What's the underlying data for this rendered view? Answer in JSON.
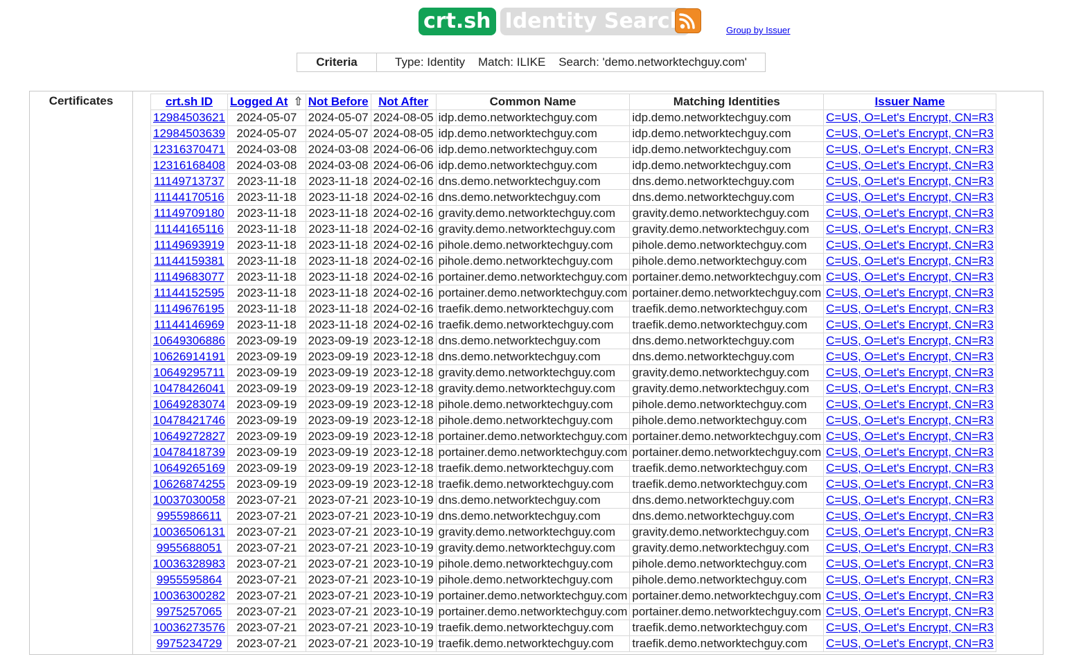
{
  "header": {
    "brand": "crt.sh",
    "subtitle": "Identity Search",
    "group_link": "Group by Issuer",
    "rss_icon": "rss-feed-icon",
    "brand_color": "#12a256",
    "rss_color": "#f08a24"
  },
  "criteria": {
    "label": "Criteria",
    "value": "Type: Identity    Match: ILIKE    Search: 'demo.networktechguy.com'"
  },
  "section_label": "Certificates",
  "table": {
    "columns": [
      "crt.sh ID",
      "Logged At",
      "Not Before",
      "Not After",
      "Common Name",
      "Matching Identities",
      "Issuer Name"
    ],
    "sort_indicator": "⇧",
    "rows": [
      [
        "12984503621",
        "2024-05-07",
        "2024-05-07",
        "2024-08-05",
        "idp.demo.networktechguy.com",
        "idp.demo.networktechguy.com",
        "C=US, O=Let's Encrypt, CN=R3"
      ],
      [
        "12984503639",
        "2024-05-07",
        "2024-05-07",
        "2024-08-05",
        "idp.demo.networktechguy.com",
        "idp.demo.networktechguy.com",
        "C=US, O=Let's Encrypt, CN=R3"
      ],
      [
        "12316370471",
        "2024-03-08",
        "2024-03-08",
        "2024-06-06",
        "idp.demo.networktechguy.com",
        "idp.demo.networktechguy.com",
        "C=US, O=Let's Encrypt, CN=R3"
      ],
      [
        "12316168408",
        "2024-03-08",
        "2024-03-08",
        "2024-06-06",
        "idp.demo.networktechguy.com",
        "idp.demo.networktechguy.com",
        "C=US, O=Let's Encrypt, CN=R3"
      ],
      [
        "11149713737",
        "2023-11-18",
        "2023-11-18",
        "2024-02-16",
        "dns.demo.networktechguy.com",
        "dns.demo.networktechguy.com",
        "C=US, O=Let's Encrypt, CN=R3"
      ],
      [
        "11144170516",
        "2023-11-18",
        "2023-11-18",
        "2024-02-16",
        "dns.demo.networktechguy.com",
        "dns.demo.networktechguy.com",
        "C=US, O=Let's Encrypt, CN=R3"
      ],
      [
        "11149709180",
        "2023-11-18",
        "2023-11-18",
        "2024-02-16",
        "gravity.demo.networktechguy.com",
        "gravity.demo.networktechguy.com",
        "C=US, O=Let's Encrypt, CN=R3"
      ],
      [
        "11144165116",
        "2023-11-18",
        "2023-11-18",
        "2024-02-16",
        "gravity.demo.networktechguy.com",
        "gravity.demo.networktechguy.com",
        "C=US, O=Let's Encrypt, CN=R3"
      ],
      [
        "11149693919",
        "2023-11-18",
        "2023-11-18",
        "2024-02-16",
        "pihole.demo.networktechguy.com",
        "pihole.demo.networktechguy.com",
        "C=US, O=Let's Encrypt, CN=R3"
      ],
      [
        "11144159381",
        "2023-11-18",
        "2023-11-18",
        "2024-02-16",
        "pihole.demo.networktechguy.com",
        "pihole.demo.networktechguy.com",
        "C=US, O=Let's Encrypt, CN=R3"
      ],
      [
        "11149683077",
        "2023-11-18",
        "2023-11-18",
        "2024-02-16",
        "portainer.demo.networktechguy.com",
        "portainer.demo.networktechguy.com",
        "C=US, O=Let's Encrypt, CN=R3"
      ],
      [
        "11144152595",
        "2023-11-18",
        "2023-11-18",
        "2024-02-16",
        "portainer.demo.networktechguy.com",
        "portainer.demo.networktechguy.com",
        "C=US, O=Let's Encrypt, CN=R3"
      ],
      [
        "11149676195",
        "2023-11-18",
        "2023-11-18",
        "2024-02-16",
        "traefik.demo.networktechguy.com",
        "traefik.demo.networktechguy.com",
        "C=US, O=Let's Encrypt, CN=R3"
      ],
      [
        "11144146969",
        "2023-11-18",
        "2023-11-18",
        "2024-02-16",
        "traefik.demo.networktechguy.com",
        "traefik.demo.networktechguy.com",
        "C=US, O=Let's Encrypt, CN=R3"
      ],
      [
        "10649306886",
        "2023-09-19",
        "2023-09-19",
        "2023-12-18",
        "dns.demo.networktechguy.com",
        "dns.demo.networktechguy.com",
        "C=US, O=Let's Encrypt, CN=R3"
      ],
      [
        "10626914191",
        "2023-09-19",
        "2023-09-19",
        "2023-12-18",
        "dns.demo.networktechguy.com",
        "dns.demo.networktechguy.com",
        "C=US, O=Let's Encrypt, CN=R3"
      ],
      [
        "10649295711",
        "2023-09-19",
        "2023-09-19",
        "2023-12-18",
        "gravity.demo.networktechguy.com",
        "gravity.demo.networktechguy.com",
        "C=US, O=Let's Encrypt, CN=R3"
      ],
      [
        "10478426041",
        "2023-09-19",
        "2023-09-19",
        "2023-12-18",
        "gravity.demo.networktechguy.com",
        "gravity.demo.networktechguy.com",
        "C=US, O=Let's Encrypt, CN=R3"
      ],
      [
        "10649283074",
        "2023-09-19",
        "2023-09-19",
        "2023-12-18",
        "pihole.demo.networktechguy.com",
        "pihole.demo.networktechguy.com",
        "C=US, O=Let's Encrypt, CN=R3"
      ],
      [
        "10478421746",
        "2023-09-19",
        "2023-09-19",
        "2023-12-18",
        "pihole.demo.networktechguy.com",
        "pihole.demo.networktechguy.com",
        "C=US, O=Let's Encrypt, CN=R3"
      ],
      [
        "10649272827",
        "2023-09-19",
        "2023-09-19",
        "2023-12-18",
        "portainer.demo.networktechguy.com",
        "portainer.demo.networktechguy.com",
        "C=US, O=Let's Encrypt, CN=R3"
      ],
      [
        "10478418739",
        "2023-09-19",
        "2023-09-19",
        "2023-12-18",
        "portainer.demo.networktechguy.com",
        "portainer.demo.networktechguy.com",
        "C=US, O=Let's Encrypt, CN=R3"
      ],
      [
        "10649265169",
        "2023-09-19",
        "2023-09-19",
        "2023-12-18",
        "traefik.demo.networktechguy.com",
        "traefik.demo.networktechguy.com",
        "C=US, O=Let's Encrypt, CN=R3"
      ],
      [
        "10626874255",
        "2023-09-19",
        "2023-09-19",
        "2023-12-18",
        "traefik.demo.networktechguy.com",
        "traefik.demo.networktechguy.com",
        "C=US, O=Let's Encrypt, CN=R3"
      ],
      [
        "10037030058",
        "2023-07-21",
        "2023-07-21",
        "2023-10-19",
        "dns.demo.networktechguy.com",
        "dns.demo.networktechguy.com",
        "C=US, O=Let's Encrypt, CN=R3"
      ],
      [
        "9955986611",
        "2023-07-21",
        "2023-07-21",
        "2023-10-19",
        "dns.demo.networktechguy.com",
        "dns.demo.networktechguy.com",
        "C=US, O=Let's Encrypt, CN=R3"
      ],
      [
        "10036506131",
        "2023-07-21",
        "2023-07-21",
        "2023-10-19",
        "gravity.demo.networktechguy.com",
        "gravity.demo.networktechguy.com",
        "C=US, O=Let's Encrypt, CN=R3"
      ],
      [
        "9955688051",
        "2023-07-21",
        "2023-07-21",
        "2023-10-19",
        "gravity.demo.networktechguy.com",
        "gravity.demo.networktechguy.com",
        "C=US, O=Let's Encrypt, CN=R3"
      ],
      [
        "10036328983",
        "2023-07-21",
        "2023-07-21",
        "2023-10-19",
        "pihole.demo.networktechguy.com",
        "pihole.demo.networktechguy.com",
        "C=US, O=Let's Encrypt, CN=R3"
      ],
      [
        "9955595864",
        "2023-07-21",
        "2023-07-21",
        "2023-10-19",
        "pihole.demo.networktechguy.com",
        "pihole.demo.networktechguy.com",
        "C=US, O=Let's Encrypt, CN=R3"
      ],
      [
        "10036300282",
        "2023-07-21",
        "2023-07-21",
        "2023-10-19",
        "portainer.demo.networktechguy.com",
        "portainer.demo.networktechguy.com",
        "C=US, O=Let's Encrypt, CN=R3"
      ],
      [
        "9975257065",
        "2023-07-21",
        "2023-07-21",
        "2023-10-19",
        "portainer.demo.networktechguy.com",
        "portainer.demo.networktechguy.com",
        "C=US, O=Let's Encrypt, CN=R3"
      ],
      [
        "10036273576",
        "2023-07-21",
        "2023-07-21",
        "2023-10-19",
        "traefik.demo.networktechguy.com",
        "traefik.demo.networktechguy.com",
        "C=US, O=Let's Encrypt, CN=R3"
      ],
      [
        "9975234729",
        "2023-07-21",
        "2023-07-21",
        "2023-10-19",
        "traefik.demo.networktechguy.com",
        "traefik.demo.networktechguy.com",
        "C=US, O=Let's Encrypt, CN=R3"
      ]
    ]
  }
}
